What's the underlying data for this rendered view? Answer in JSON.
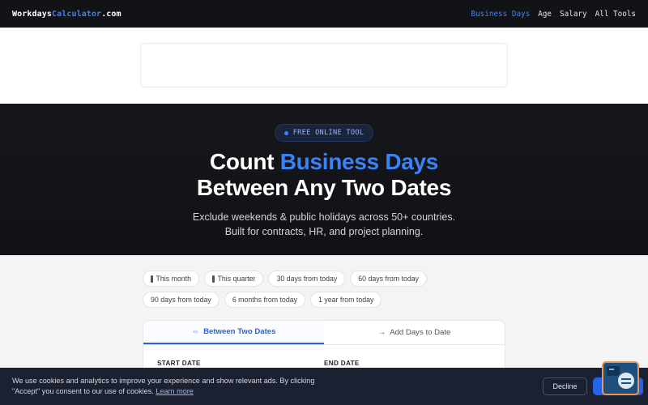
{
  "header": {
    "logo_part1": "Workdays",
    "logo_part2": "Calculator",
    "logo_part3": ".com",
    "nav": [
      "Business Days",
      "Age",
      "Salary",
      "All Tools"
    ],
    "active_nav": "Business Days"
  },
  "hero": {
    "badge": "FREE ONLINE TOOL",
    "title_prefix": "Count ",
    "title_highlight": "Business Days",
    "title_line2": "Between Any Two Dates",
    "subtitle_line1": "Exclude weekends & public holidays across 50+ countries.",
    "subtitle_line2": "Built for contracts, HR, and project planning."
  },
  "quick_ranges": [
    "This month",
    "This quarter",
    "30 days from today",
    "60 days from today",
    "90 days from today",
    "6 months from today",
    "1 year from today"
  ],
  "calculator": {
    "tab_between": "Between Two Dates",
    "tab_add": "Add Days to Date",
    "start_label": "START DATE",
    "end_label": "END DATE"
  },
  "cookie": {
    "text": "We use cookies and analytics to improve your experience and show relevant ads. By clicking \"Accept\" you consent to our use of cookies.",
    "learn_more": "Learn more",
    "decline": "Decline",
    "accept": "Accept"
  },
  "colors": {
    "accent": "#3b82f6",
    "nav_bg": "#121317",
    "cookie_bg": "#1c2132"
  }
}
